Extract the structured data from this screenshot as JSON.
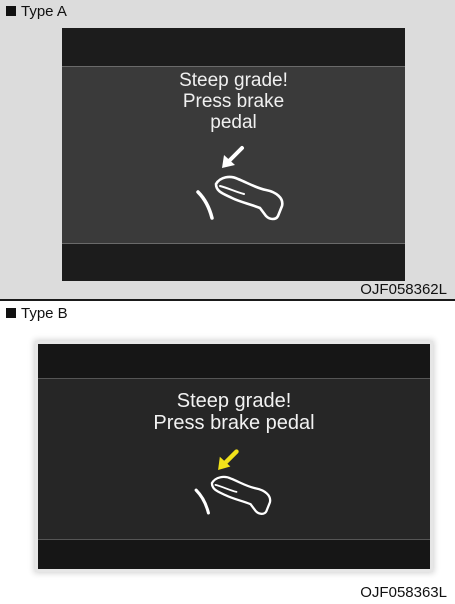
{
  "type_a": {
    "label": "Type A",
    "message": [
      "Steep grade!",
      "Press brake",
      "pedal"
    ],
    "code": "OJF058362L",
    "arrow_color": "#ffffff"
  },
  "type_b": {
    "label": "Type B",
    "message": [
      "Steep grade!",
      "Press brake pedal"
    ],
    "code": "OJF058363L",
    "arrow_color": "#f2e21a"
  },
  "icons": [
    "arrow-icon",
    "brake-pedal-foot-icon"
  ]
}
